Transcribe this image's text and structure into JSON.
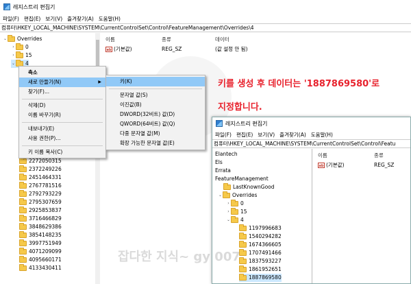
{
  "main_window": {
    "title": "레지스트리 편집기",
    "menu": [
      "파일(F)",
      "편집(E)",
      "보기(V)",
      "즐겨찾기(A)",
      "도움말(H)"
    ],
    "address": "컴퓨터\\HKEY_LOCAL_MACHINE\\SYSTEM\\CurrentControlSet\\Control\\FeatureManagement\\Overrides\\4",
    "tree": [
      {
        "label": "Overrides",
        "chev": "⌄"
      },
      {
        "label": "0",
        "chev": "›"
      },
      {
        "label": "15",
        "chev": "›"
      },
      {
        "label": "4",
        "chev": "⌄"
      },
      {
        "label": "2272050315",
        "chev": ""
      },
      {
        "label": "2372249226",
        "chev": ""
      },
      {
        "label": "2451464331",
        "chev": ""
      },
      {
        "label": "2767781516",
        "chev": ""
      },
      {
        "label": "2792793229",
        "chev": ""
      },
      {
        "label": "2795307659",
        "chev": ""
      },
      {
        "label": "2925853837",
        "chev": ""
      },
      {
        "label": "3716466829",
        "chev": ""
      },
      {
        "label": "3848629386",
        "chev": ""
      },
      {
        "label": "3854148235",
        "chev": ""
      },
      {
        "label": "3997751949",
        "chev": ""
      },
      {
        "label": "4071209099",
        "chev": ""
      },
      {
        "label": "4095660171",
        "chev": ""
      },
      {
        "label": "4133430411",
        "chev": ""
      }
    ],
    "columns": {
      "name": "이름",
      "type": "종류",
      "data": "데이터"
    },
    "values": [
      {
        "name": "(기본값)",
        "type": "REG_SZ",
        "data": "(값 설정 안 됨)"
      }
    ]
  },
  "context_menu": {
    "items": [
      "축소",
      "새로 만들기(N)",
      "찾기(F)...",
      "삭제(D)",
      "이름 바꾸기(R)",
      "내보내기(E)",
      "사용 권한(P)...",
      "키 이름 복사(C)"
    ]
  },
  "submenu": {
    "items": [
      "키(K)",
      "문자열 값(S)",
      "이진값(B)",
      "DWORD(32비트) 값(D)",
      "QWORD(64비트) 값(Q)",
      "다중 문자열 값(M)",
      "확장 가능한 문자열 값(E)"
    ]
  },
  "callout": {
    "line1": "키를 생성 후 데이터는 '1887869580'로",
    "line2": "지정합니다."
  },
  "second_window": {
    "title": "레지스트리 편집기",
    "menu": [
      "파일(F)",
      "편집(E)",
      "보기(V)",
      "즐겨찾기(A)",
      "도움말(H)"
    ],
    "address": "컴퓨터\\HKEY_LOCAL_MACHINE\\SYSTEM\\CurrentControlSet\\Control\\Featu",
    "tree": [
      {
        "label": "Elantech",
        "indent": 0,
        "chev": "",
        "folder": false
      },
      {
        "label": "Els",
        "indent": 0,
        "chev": "",
        "folder": false
      },
      {
        "label": "Errata",
        "indent": 0,
        "chev": "",
        "folder": false
      },
      {
        "label": "FeatureManagement",
        "indent": 0,
        "chev": "",
        "folder": false
      },
      {
        "label": "LastKnownGood",
        "indent": 1,
        "chev": "",
        "folder": true
      },
      {
        "label": "Overrides",
        "indent": 1,
        "chev": "⌄",
        "folder": true
      },
      {
        "label": "0",
        "indent": 2,
        "chev": "›",
        "folder": true
      },
      {
        "label": "15",
        "indent": 2,
        "chev": "›",
        "folder": true
      },
      {
        "label": "4",
        "indent": 2,
        "chev": "⌄",
        "folder": true
      },
      {
        "label": "1197996683",
        "indent": 3,
        "chev": "",
        "folder": true
      },
      {
        "label": "1540294282",
        "indent": 3,
        "chev": "",
        "folder": true
      },
      {
        "label": "1674366605",
        "indent": 3,
        "chev": "",
        "folder": true
      },
      {
        "label": "1707491466",
        "indent": 3,
        "chev": "",
        "folder": true
      },
      {
        "label": "1837593227",
        "indent": 3,
        "chev": "",
        "folder": true
      },
      {
        "label": "1861952651",
        "indent": 3,
        "chev": "",
        "folder": true
      },
      {
        "label": "1887869580",
        "indent": 3,
        "chev": "",
        "folder": true,
        "selected": true
      }
    ],
    "columns": {
      "name": "이름",
      "type": "종류"
    },
    "values": [
      {
        "name": "(기본값)",
        "type": "REG_SZ"
      }
    ]
  },
  "watermark": "잡다한 지식~ gy 007",
  "colors": {
    "accent_red": "#e8222d",
    "selection": "#cce8ff",
    "menu_highlight": "#91c9f7",
    "folder": "#f6c94a"
  }
}
